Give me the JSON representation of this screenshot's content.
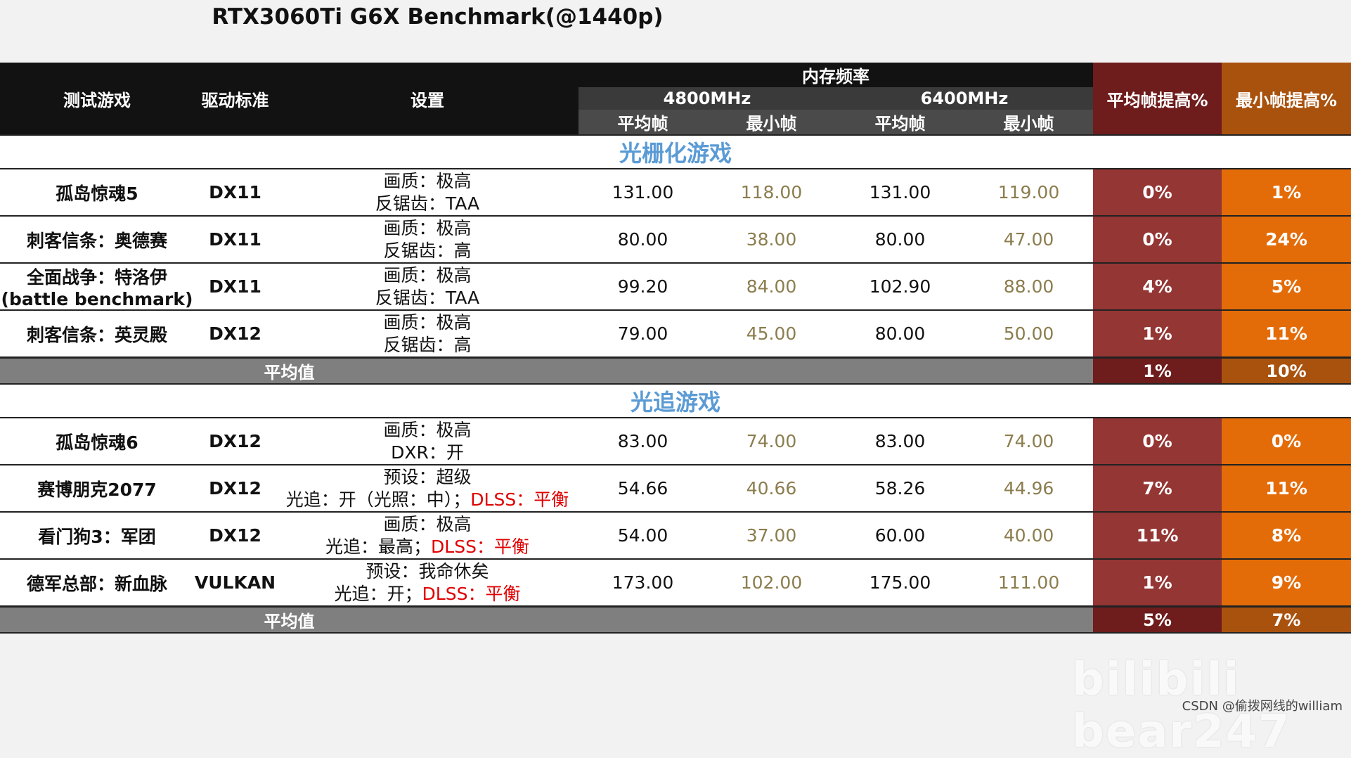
{
  "title": "RTX3060Ti G6X Benchmark(@1440p)",
  "headers": {
    "game": "测试游戏",
    "api": "驱动标准",
    "settings": "设置",
    "memory": "内存频率",
    "freq1": "4800MHz",
    "freq2": "6400MHz",
    "avg_fps": "平均帧",
    "min_fps": "最小帧",
    "avg_gain": "平均帧提高%",
    "min_gain": "最小帧提高%"
  },
  "sections": [
    {
      "title": "光栅化游戏",
      "rows": [
        {
          "game": "孤岛惊魂5",
          "game2": "",
          "api": "DX11",
          "s1": "画质：极高",
          "s2a": "反锯齿：TAA",
          "s2b": "",
          "a1": "131.00",
          "m1": "118.00",
          "a2": "131.00",
          "m2": "119.00",
          "pa": "0%",
          "pm": "1%"
        },
        {
          "game": "刺客信条：奥德赛",
          "game2": "",
          "api": "DX11",
          "s1": "画质：极高",
          "s2a": "反锯齿：高",
          "s2b": "",
          "a1": "80.00",
          "m1": "38.00",
          "a2": "80.00",
          "m2": "47.00",
          "pa": "0%",
          "pm": "24%"
        },
        {
          "game": "全面战争：特洛伊",
          "game2": "(battle benchmark)",
          "api": "DX11",
          "s1": "画质：极高",
          "s2a": "反锯齿：TAA",
          "s2b": "",
          "a1": "99.20",
          "m1": "84.00",
          "a2": "102.90",
          "m2": "88.00",
          "pa": "4%",
          "pm": "5%"
        },
        {
          "game": "刺客信条：英灵殿",
          "game2": "",
          "api": "DX12",
          "s1": "画质：极高",
          "s2a": "反锯齿：高",
          "s2b": "",
          "a1": "79.00",
          "m1": "45.00",
          "a2": "80.00",
          "m2": "50.00",
          "pa": "1%",
          "pm": "11%"
        }
      ],
      "summary": {
        "label": "平均值",
        "pa": "1%",
        "pm": "10%"
      }
    },
    {
      "title": "光追游戏",
      "rows": [
        {
          "game": "孤岛惊魂6",
          "game2": "",
          "api": "DX12",
          "s1": "画质：极高",
          "s2a": "DXR：开",
          "s2b": "",
          "a1": "83.00",
          "m1": "74.00",
          "a2": "83.00",
          "m2": "74.00",
          "pa": "0%",
          "pm": "0%"
        },
        {
          "game": "赛博朋克2077",
          "game2": "",
          "api": "DX12",
          "s1": "预设：超级",
          "s2a": "光追：开（光照：中）；",
          "s2b": "DLSS：平衡",
          "a1": "54.66",
          "m1": "40.66",
          "a2": "58.26",
          "m2": "44.96",
          "pa": "7%",
          "pm": "11%"
        },
        {
          "game": "看门狗3：军团",
          "game2": "",
          "api": "DX12",
          "s1": "画质：极高",
          "s2a": "光追：最高；",
          "s2b": "DLSS：平衡",
          "a1": "54.00",
          "m1": "37.00",
          "a2": "60.00",
          "m2": "40.00",
          "pa": "11%",
          "pm": "8%"
        },
        {
          "game": "德军总部：新血脉",
          "game2": "",
          "api": "VULKAN",
          "s1": "预设：我命休矣",
          "s2a": "光追：开；",
          "s2b": "DLSS：平衡",
          "a1": "173.00",
          "m1": "102.00",
          "a2": "175.00",
          "m2": "111.00",
          "pa": "1%",
          "pm": "9%"
        }
      ],
      "summary": {
        "label": "平均值",
        "pa": "5%",
        "pm": "7%"
      }
    }
  ],
  "watermark": "bilibili bear247",
  "csdn": "CSDN @偷拨网线的william",
  "colors": {
    "header_bg": "#121212",
    "avg_gain_bg": "#943634",
    "min_gain_bg": "#e36c09",
    "section_title": "#5b9bd5",
    "min_fps_text": "#8b7d4e",
    "dlss_text": "#e00000"
  }
}
